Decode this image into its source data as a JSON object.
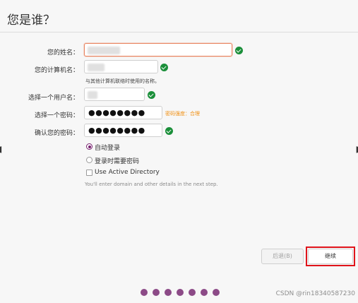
{
  "window": {
    "title": "您是谁？"
  },
  "form": {
    "name_label": "您的姓名：",
    "computer_label": "您的计算机名：",
    "computer_hint": "与其他计算机联络时使用的名称。",
    "username_label": "选择一个用户名：",
    "password_label": "选择一个密码：",
    "password_value": "●●●●●●●●",
    "password_strength": "密码强度：合理",
    "confirm_label": "确认您的密码：",
    "confirm_value": "●●●●●●●●"
  },
  "login_options": {
    "auto_login": "自动登录",
    "require_password": "登录时需要密码",
    "selected": "auto_login"
  },
  "active_directory": {
    "label": "Use Active Directory",
    "checked": false,
    "hint": "You'll enter domain and other details in the next step."
  },
  "buttons": {
    "back": "后退(B)",
    "next": "继续"
  },
  "progress": {
    "total_steps": 7
  },
  "colors": {
    "accent": "#77216f",
    "dot": "#8c4a87",
    "valid": "#1b8f3a",
    "highlight": "#e0141b",
    "strength": "#f09014",
    "focus": "#e8835f"
  },
  "watermark": "CSDN @rin18340587230"
}
